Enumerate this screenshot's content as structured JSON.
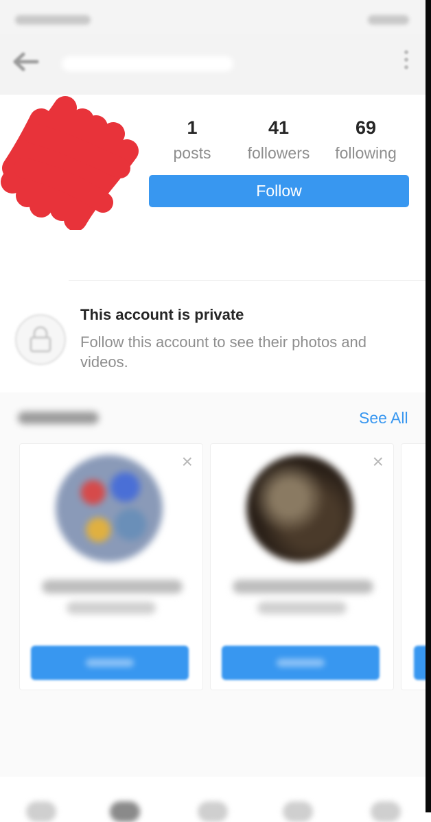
{
  "profile": {
    "posts": {
      "count": "1",
      "label": "posts"
    },
    "followers": {
      "count": "41",
      "label": "followers"
    },
    "following": {
      "count": "69",
      "label": "following"
    },
    "follow_label": "Follow"
  },
  "private_notice": {
    "title": "This account is private",
    "description": "Follow this account to see their photos and videos."
  },
  "suggested": {
    "see_all": "See All",
    "close_glyph": "×"
  },
  "colors": {
    "accent": "#3897f0",
    "scribble": "#e8333a",
    "muted_text": "#8e8e8e"
  },
  "icons": [
    "back-arrow-icon",
    "more-options-icon",
    "lock-icon",
    "close-icon"
  ]
}
